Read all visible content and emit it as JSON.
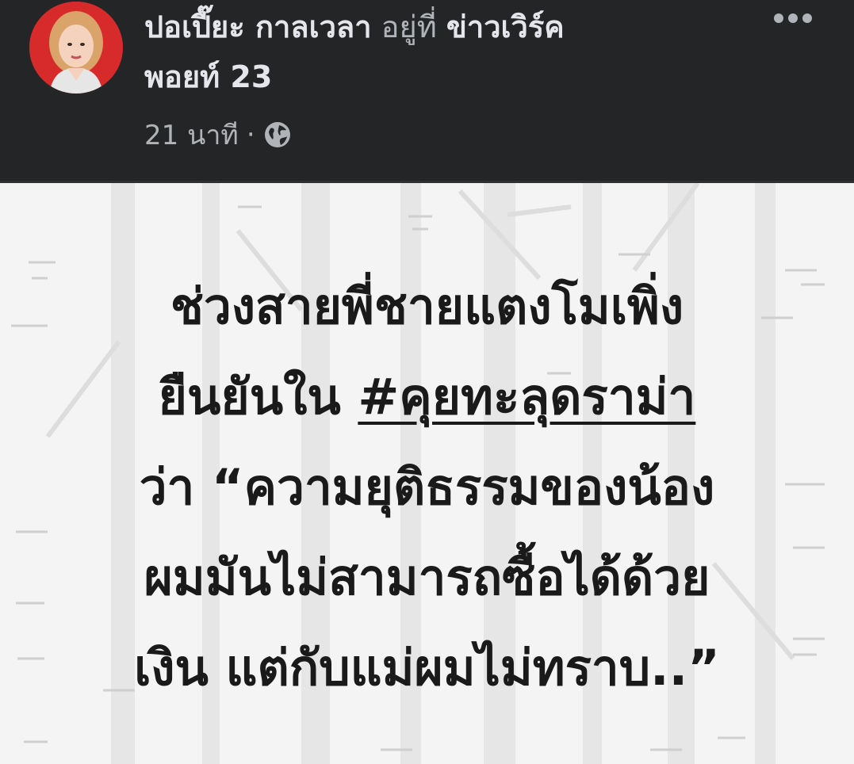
{
  "post": {
    "author": "ปอเปี๊ยะ กาลเวลา",
    "location_prefix": "อยู่ที่",
    "location_part1": "ข่าวเวิร์ค",
    "location_part2": "พอยท์ 23",
    "time": "21 นาที",
    "separator": "·",
    "privacy_icon": "globe-icon",
    "more_icon": "more-options-icon"
  },
  "image_text": {
    "line1": "ช่วงสายพี่ชายแตงโมเพิ่ง",
    "line2_prefix": "ยืนยันใน",
    "line2_hashtag": "#คุยทะลุดราม่า",
    "line3": "ว่า “ความยุติธรรมของน้อง",
    "line4": "ผมมันไม่สามารถซื้อได้ด้วย",
    "line5": "เงิน แต่กับแม่ผมไม่ทราบ..”"
  },
  "colors": {
    "header_bg": "#242526",
    "primary_text": "#e4e6eb",
    "secondary_text": "#b0b3b8",
    "image_bg": "#f4f4f4",
    "quote_text": "#1a1a1a",
    "avatar_bg": "#d72b2b"
  }
}
